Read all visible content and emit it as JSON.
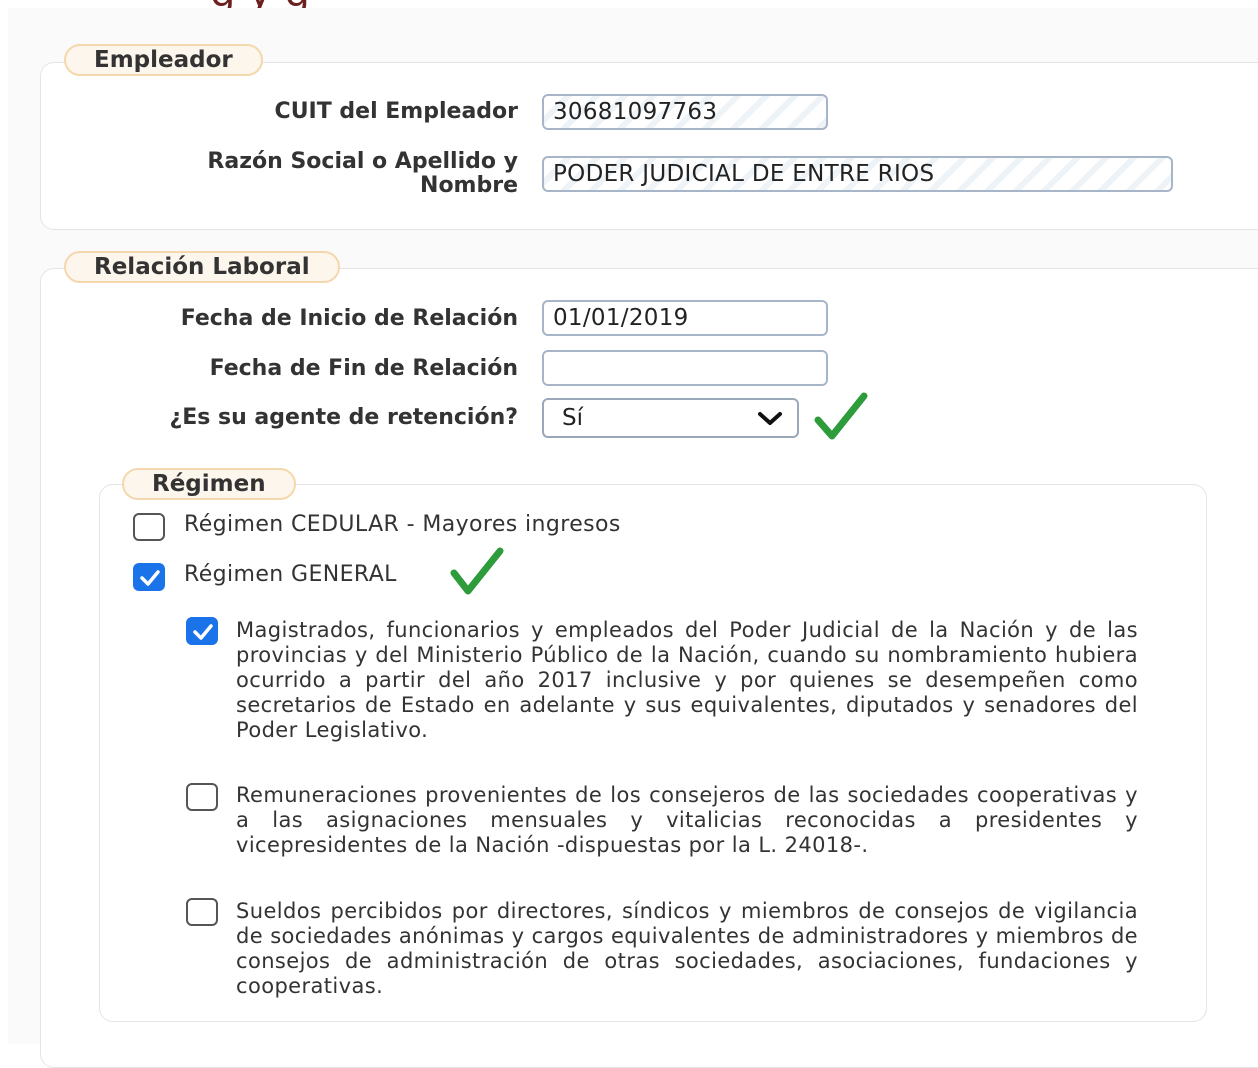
{
  "header": {
    "title_fragment": "g y g"
  },
  "empleador": {
    "legend": "Empleador",
    "cuit_label": "CUIT del Empleador",
    "cuit_value": "30681097763",
    "razon_label_line1": "Razón Social o Apellido y",
    "razon_label_line2": "Nombre",
    "razon_value": "PODER JUDICIAL DE ENTRE RIOS"
  },
  "relacion": {
    "legend": "Relación Laboral",
    "inicio_label": "Fecha de Inicio de Relación",
    "inicio_value": "01/01/2019",
    "fin_label": "Fecha de Fin de Relación",
    "fin_value": "",
    "retencion_label": "¿Es su agente de retención?",
    "retencion_value": "Sí"
  },
  "regimen": {
    "legend": "Régimen",
    "cedular_label": "Régimen CEDULAR - Mayores ingresos",
    "cedular_checked": false,
    "general_label": "Régimen GENERAL",
    "general_checked": true,
    "options": [
      {
        "text": "Magistrados, funcionarios y empleados del Poder Judicial de la Nación y de las provincias y del Ministerio Público de la Nación, cuando su nombramiento hubiera ocurrido a partir del año 2017 inclusive y por quienes se desempeñen como secretarios de Estado en adelante y sus equivalentes, diputados y senadores del Poder Legislativo.",
        "checked": true
      },
      {
        "text": "Remuneraciones provenientes de los consejeros de las sociedades cooperativas y a las asignaciones mensuales y vitalicias reconocidas a presidentes y vicepresidentes de la Nación -dispuestas por la L. 24018-.",
        "checked": false
      },
      {
        "text": "Sueldos percibidos por directores, síndicos y miembros de consejos de vigilancia de sociedades anónimas y cargos equivalentes de administradores y miembros de consejos de administración de otras sociedades, asociaciones, fundaciones y cooperativas.",
        "checked": false
      }
    ]
  },
  "colors": {
    "accent": "#1a73e8",
    "check_mark": "#2e9c3a",
    "legend_bg": "#fdf6ec",
    "legend_border": "#f5d7ad"
  },
  "icons": [
    "chevron-down-icon",
    "green-check-icon",
    "checkbox-check-icon"
  ]
}
